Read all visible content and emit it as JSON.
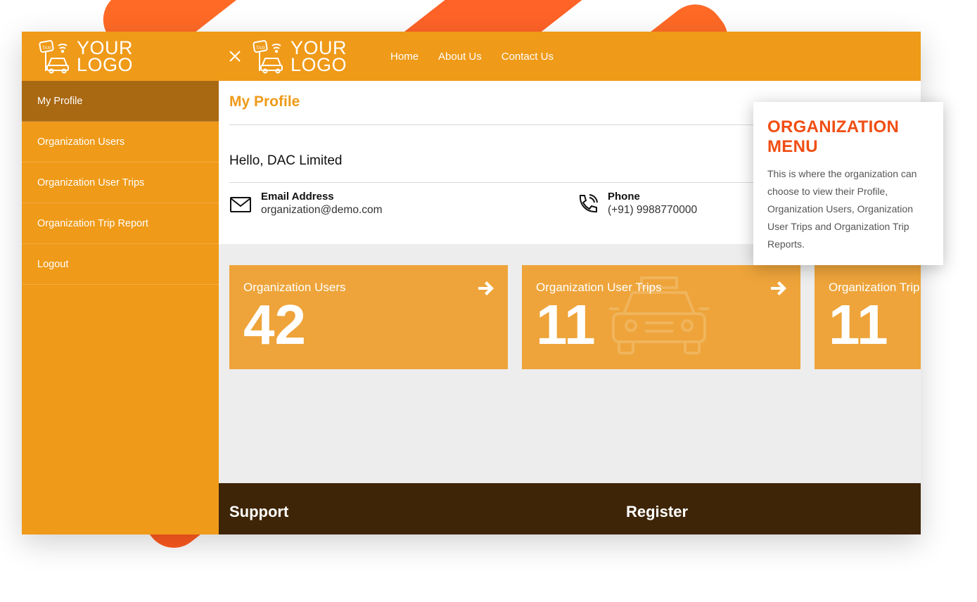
{
  "logo": {
    "line1": "YOUR",
    "line2": "LOGO",
    "badge": "TAXI"
  },
  "sidebar": {
    "items": [
      {
        "label": "My Profile"
      },
      {
        "label": "Organization Users"
      },
      {
        "label": "Organization User Trips"
      },
      {
        "label": "Organization Trip Report"
      },
      {
        "label": "Logout"
      }
    ]
  },
  "topnav": {
    "links": [
      {
        "label": "Home"
      },
      {
        "label": "About Us"
      },
      {
        "label": "Contact Us"
      }
    ]
  },
  "profile": {
    "title": "My Profile",
    "greeting": "Hello, DAC Limited",
    "email_label": "Email Address",
    "email_value": "organization@demo.com",
    "phone_label": "Phone",
    "phone_value": "(+91) 9988770000"
  },
  "stats": [
    {
      "title": "Organization Users",
      "value": "42"
    },
    {
      "title": "Organization User Trips",
      "value": "11"
    },
    {
      "title": "Organization Trip Report",
      "value": "11"
    }
  ],
  "footer": {
    "support": "Support",
    "register": "Register"
  },
  "callout": {
    "title": "ORGANIZATION MENU",
    "text": "This is where the organization can choose to view their Profile, Organization Users, Organization User Trips and Organization Trip Reports."
  },
  "colors": {
    "accent": "#ef9a18",
    "active": "#a96812",
    "card": "#eea43a",
    "footer": "#3f2507",
    "callout_title": "#f04e13",
    "stripe": "#ff5a1f"
  },
  "icons": {
    "close": "close-icon",
    "email": "mail-icon",
    "phone": "phone-icon",
    "arrow": "arrow-right-icon",
    "car": "car-icon",
    "logo": "taxi-logo-icon"
  }
}
